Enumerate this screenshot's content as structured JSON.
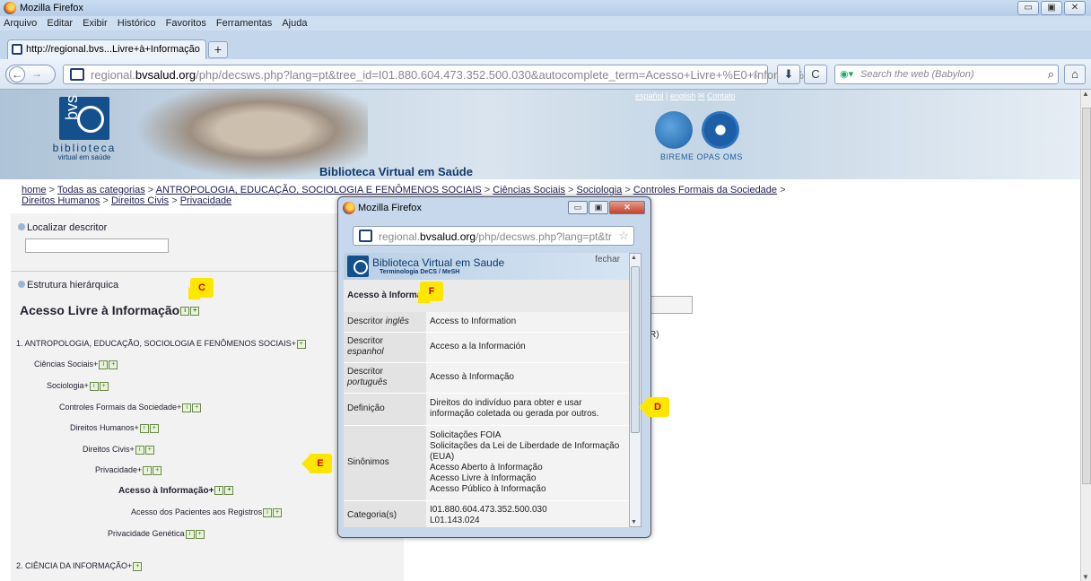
{
  "window": {
    "title": "Mozilla Firefox",
    "controls": [
      "▭",
      "▣",
      "✕"
    ]
  },
  "menu": [
    "Arquivo",
    "Editar",
    "Exibir",
    "Histórico",
    "Favoritos",
    "Ferramentas",
    "Ajuda"
  ],
  "tabs": [
    {
      "label": "http://regional.bvs...Livre+à+Informação"
    }
  ],
  "new_tab": "+",
  "navbar": {
    "back": "←",
    "forward": "→",
    "url_domain_pre": "regional.",
    "url_domain": "bvsalud.org",
    "url_path": "/php/decsws.php?lang=pt&tree_id=I01.880.604.473.352.500.030&autocomplete_term=Acesso+Livre+%E0+Informa%E",
    "star": "☆",
    "download": "⬇",
    "reload": "C",
    "search_placeholder": "Search the web (Babylon)",
    "search_icon": "⌕",
    "home": "⌂"
  },
  "banner": {
    "logo_short": "bvs",
    "logo_name": "biblioteca",
    "logo_sub": "virtual em saúde",
    "site_title": "Biblioteca Virtual em Saúde",
    "toplinks": [
      "español",
      "english",
      "Contato"
    ],
    "partners": "BIREME  OPAS  OMS"
  },
  "breadcrumb": {
    "items": [
      "home",
      "Todas as categorias",
      "ANTROPOLOGIA, EDUCAÇÃO, SOCIOLOGIA E FENÔMENOS SOCIAIS",
      "Ciências Sociais",
      "Sociologia",
      "Controles Formais da Sociedade",
      "Direitos Humanos",
      "Direitos Civis",
      "Privacidade"
    ],
    "separator": " > "
  },
  "left": {
    "locate_label": "Localizar descritor",
    "structure_label": "Estrutura hierárquica",
    "concept": "Acesso Livre à Informação",
    "tree": [
      {
        "label": "1.  ANTROPOLOGIA, EDUCAÇÃO, SOCIOLOGIA E FENÔMENOS SOCIAIS+"
      },
      {
        "label": "Ciências Sociais+"
      },
      {
        "label": "Sociologia+"
      },
      {
        "label": "Controles Formais da Sociedade+"
      },
      {
        "label": "Direitos Humanos+"
      },
      {
        "label": "Direitos Civis+"
      },
      {
        "label": "Privacidade+"
      },
      {
        "label": "Acesso à Informação+"
      },
      {
        "label": "Acesso dos Pacientes aos Registros"
      },
      {
        "label": "Privacidade Genética"
      },
      {
        "label": "2.  CIÊNCIA DA INFORMAÇÃO+"
      }
    ]
  },
  "right": {
    "r_text": "R)"
  },
  "popup": {
    "title": "Mozilla Firefox",
    "url_pre": "regional.",
    "url_domain": "bvsalud.org",
    "url_path": "/php/decsws.php?lang=pt&tr",
    "header_title": "Biblioteca Virtual em Saude",
    "header_sub": "Terminologia DeCS / MeSH",
    "close_link": "fechar",
    "subheader": "Acesso à Informação",
    "rows": [
      {
        "key": "Descritor ",
        "key_sub": "inglês",
        "value": "Access to Information"
      },
      {
        "key": "Descritor",
        "key_sub": "espanhol",
        "value": "Acceso a la Información"
      },
      {
        "key": "Descritor",
        "key_sub": "português",
        "value": "Acesso à Informação"
      },
      {
        "key": "Definição",
        "key_sub": "",
        "value": "Direitos do indivíduo para obter e usar informação coletada ou gerada por outros."
      },
      {
        "key": "Sinônimos",
        "key_sub": "",
        "value": "Solicitações FOIA\nSolicitações da Lei de Liberdade de Informação (EUA)\nAcesso Aberto à Informação\nAcesso Livre à Informação\nAcesso Público à Informação"
      },
      {
        "key": "Categoria(s)",
        "key_sub": "",
        "value": "I01.880.604.473.352.500.030\nL01.143.024"
      }
    ]
  },
  "callouts": {
    "c": "C",
    "f": "F",
    "d": "D",
    "e": "E"
  }
}
